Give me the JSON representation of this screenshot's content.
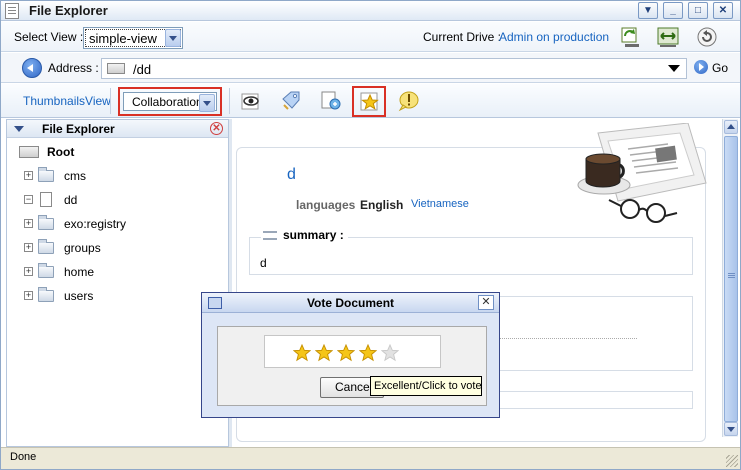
{
  "window": {
    "title": "File Explorer"
  },
  "view_row": {
    "select_label": "Select View :",
    "view_value": "simple-view",
    "drive_label": "Current Drive :",
    "drive_value": "Admin on production"
  },
  "address_row": {
    "label": "Address :",
    "path": "/dd",
    "go_label": "Go"
  },
  "toolbar": {
    "thumbnails_link": "ThumbnailsView",
    "collab_value": "Collaboration",
    "icons": [
      "watch-icon",
      "tag-icon",
      "relation-icon",
      "vote-star-icon",
      "comment-icon"
    ]
  },
  "tree": {
    "header": "File Explorer",
    "root": "Root",
    "items": [
      {
        "label": "cms",
        "icon": "folder-icon",
        "expander": "+"
      },
      {
        "label": "dd",
        "icon": "document-icon",
        "expander": "−"
      },
      {
        "label": "exo:registry",
        "icon": "folder-icon",
        "expander": "+"
      },
      {
        "label": "groups",
        "icon": "folder-icon",
        "expander": "+"
      },
      {
        "label": "home",
        "icon": "folder-icon",
        "expander": "+"
      },
      {
        "label": "users",
        "icon": "folder-icon",
        "expander": "+"
      }
    ]
  },
  "document": {
    "title": "d",
    "languages_label": "languages",
    "language_current": "English",
    "language_alt": "Vietnamese",
    "summary_label": "summary :",
    "summary_value": "d"
  },
  "vote_dialog": {
    "title": "Vote Document",
    "stars_filled": 4,
    "stars_total": 5,
    "cancel_label": "Cancel",
    "tooltip": "Excellent/Click to vote"
  },
  "status": {
    "text": "Done"
  },
  "colors": {
    "link": "#1764c0",
    "highlight": "#d93025",
    "star": "#f5c518"
  }
}
